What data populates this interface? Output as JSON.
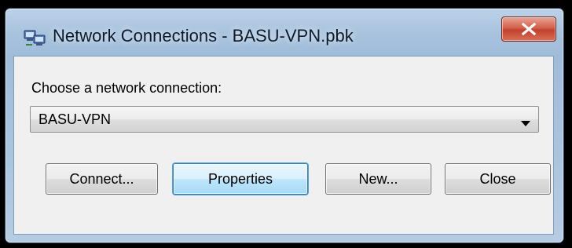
{
  "window": {
    "title": "Network Connections - BASU-VPN.pbk",
    "close_glyph": "X"
  },
  "icons": {
    "app": "network-connections-icon",
    "close": "close-icon",
    "dropdown": "chevron-down-icon"
  },
  "dialog": {
    "prompt": "Choose a network connection:",
    "selected_connection": "BASU-VPN",
    "buttons": {
      "connect": "Connect...",
      "properties": "Properties",
      "new": "New...",
      "close": "Close"
    }
  },
  "colors": {
    "title_bar": "#a9c3de",
    "close_button": "#c1422d",
    "default_button": "#bee6fd",
    "client_area": "#f0f0f0"
  }
}
